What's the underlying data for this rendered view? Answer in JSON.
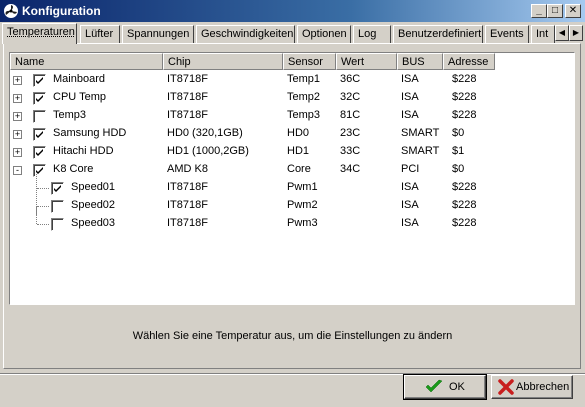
{
  "window": {
    "title": "Konfiguration"
  },
  "tabs": [
    {
      "label": "Temperaturen"
    },
    {
      "label": "Lüfter"
    },
    {
      "label": "Spannungen"
    },
    {
      "label": "Geschwindigkeiten"
    },
    {
      "label": "Optionen"
    },
    {
      "label": "Log"
    },
    {
      "label": "Benutzerdefiniert"
    },
    {
      "label": "Events"
    },
    {
      "label": "Int"
    }
  ],
  "table": {
    "columns": [
      "Name",
      "Chip",
      "Sensor",
      "Wert",
      "BUS",
      "Adresse"
    ],
    "rows": [
      {
        "name": "Mainboard",
        "chip": "IT8718F",
        "sensor": "Temp1",
        "wert": "36C",
        "bus": "ISA",
        "adresse": "$228",
        "checked": true,
        "expander": "+"
      },
      {
        "name": "CPU Temp",
        "chip": "IT8718F",
        "sensor": "Temp2",
        "wert": "32C",
        "bus": "ISA",
        "adresse": "$228",
        "checked": true,
        "expander": "+"
      },
      {
        "name": "Temp3",
        "chip": "IT8718F",
        "sensor": "Temp3",
        "wert": "81C",
        "bus": "ISA",
        "adresse": "$228",
        "checked": false,
        "expander": "+"
      },
      {
        "name": "Samsung HDD",
        "chip": "HD0 (320,1GB)",
        "sensor": "HD0",
        "wert": "23C",
        "bus": "SMART",
        "adresse": "$0",
        "checked": true,
        "expander": "+"
      },
      {
        "name": "Hitachi HDD",
        "chip": "HD1 (1000,2GB)",
        "sensor": "HD1",
        "wert": "33C",
        "bus": "SMART",
        "adresse": "$1",
        "checked": true,
        "expander": "+"
      },
      {
        "name": "K8 Core",
        "chip": "AMD K8",
        "sensor": "Core",
        "wert": "34C",
        "bus": "PCI",
        "adresse": "$0",
        "checked": true,
        "expander": "-"
      },
      {
        "name": "Speed01",
        "chip": "IT8718F",
        "sensor": "Pwm1",
        "wert": "",
        "bus": "ISA",
        "adresse": "$228",
        "checked": true,
        "child": true
      },
      {
        "name": "Speed02",
        "chip": "IT8718F",
        "sensor": "Pwm2",
        "wert": "",
        "bus": "ISA",
        "adresse": "$228",
        "checked": false,
        "child": true
      },
      {
        "name": "Speed03",
        "chip": "IT8718F",
        "sensor": "Pwm3",
        "wert": "",
        "bus": "ISA",
        "adresse": "$228",
        "checked": false,
        "child": true
      }
    ]
  },
  "status": {
    "text": "Wählen Sie eine Temperatur aus, um die Einstellungen zu ändern"
  },
  "buttons": {
    "ok": "OK",
    "cancel": "Abbrechen"
  },
  "colors": {
    "titlebar_start": "#0a246a",
    "titlebar_end": "#a6caf0",
    "face": "#d4d0c8",
    "ok_green": "#1a9a1a",
    "cancel_red": "#c81e1e"
  }
}
